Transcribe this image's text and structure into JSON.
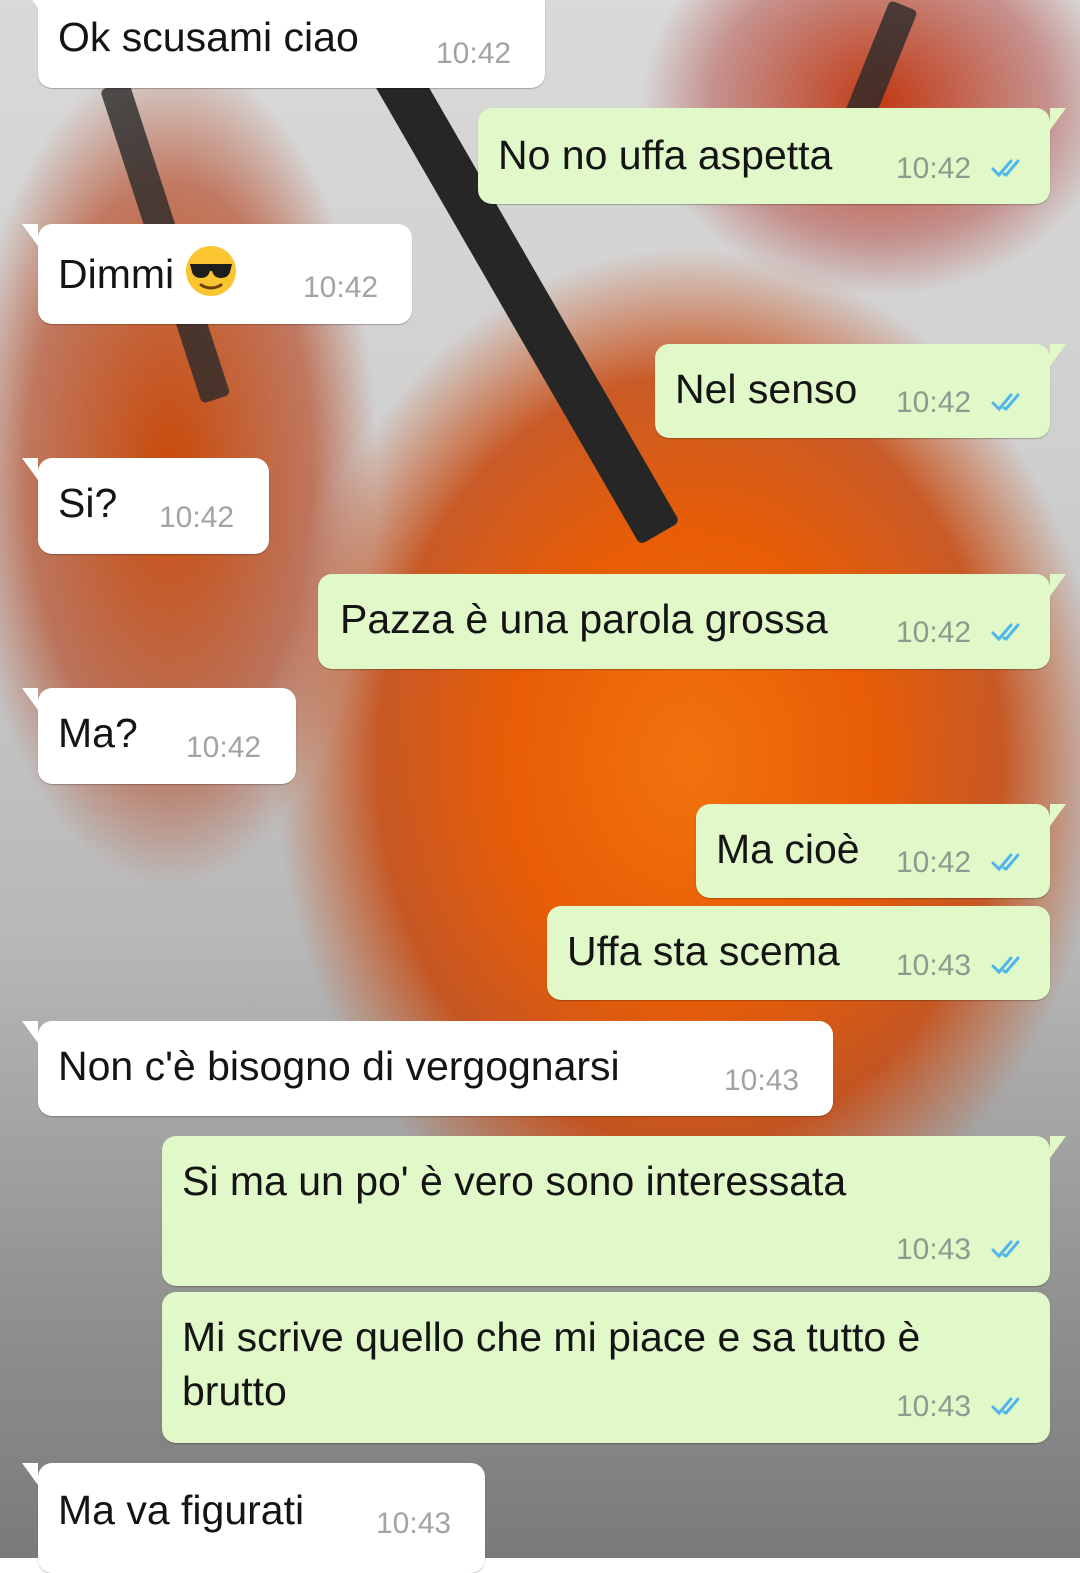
{
  "colors": {
    "incoming_bubble": "#ffffff",
    "outgoing_bubble": "#e1f8c9",
    "read_tick": "#4fb6ec",
    "timestamp": "#8e9a8e"
  },
  "messages": [
    {
      "direction": "in",
      "text": "Ok scusami ciao",
      "time": "10:42"
    },
    {
      "direction": "out",
      "text": "No no uffa aspetta",
      "time": "10:42",
      "status": "read"
    },
    {
      "direction": "in",
      "text": "Dimmi",
      "emoji": "sunglasses-face",
      "time": "10:42"
    },
    {
      "direction": "out",
      "text": "Nel senso",
      "time": "10:42",
      "status": "read"
    },
    {
      "direction": "in",
      "text": "Si?",
      "time": "10:42"
    },
    {
      "direction": "out",
      "text": "Pazza è una parola grossa",
      "time": "10:42",
      "status": "read"
    },
    {
      "direction": "in",
      "text": "Ma?",
      "time": "10:42"
    },
    {
      "direction": "out",
      "text": "Ma cioè",
      "time": "10:42",
      "status": "read"
    },
    {
      "direction": "out",
      "text": "Uffa sta scema",
      "time": "10:43",
      "status": "read"
    },
    {
      "direction": "in",
      "text": "Non c'è bisogno di vergognarsi",
      "time": "10:43"
    },
    {
      "direction": "out",
      "text": "Si ma un po' è vero sono interessata",
      "time": "10:43",
      "status": "read"
    },
    {
      "direction": "out",
      "text": "Mi scrive quello che mi piace e sa tutto è brutto",
      "time": "10:43",
      "status": "read"
    },
    {
      "direction": "in",
      "text": "Ma va figurati",
      "time": "10:43"
    }
  ]
}
